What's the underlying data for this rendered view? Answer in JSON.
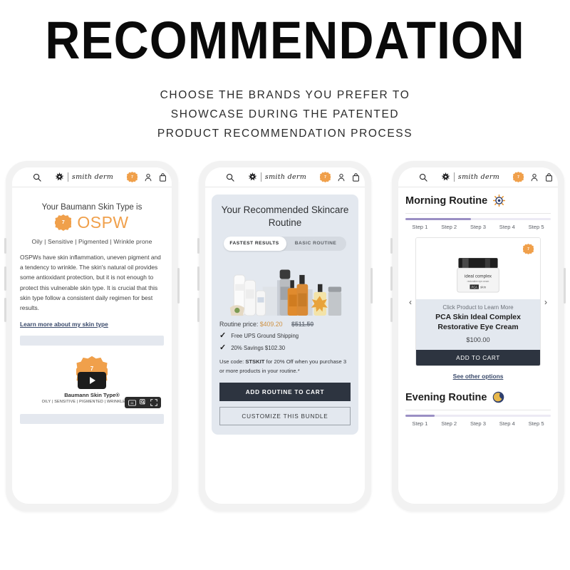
{
  "header": {
    "title": "RECOMMENDATION",
    "subtitle_lines": [
      "CHOOSE THE BRANDS YOU PREFER TO",
      "SHOWCASE DURING THE PATENTED",
      "PRODUCT RECOMMENDATION PROCESS"
    ]
  },
  "appbar": {
    "brand_name": "smith derm",
    "badge_count": "7",
    "menu_icon": "hamburger-icon",
    "search_icon": "search-icon",
    "account_icon": "account-icon",
    "bag_icon": "shopping-bag-icon"
  },
  "colors": {
    "accent_orange": "#f0a04b",
    "dark_button": "#2d3440",
    "card_blue_grey": "#e3e8ef",
    "progress_purple": "#9a8fc4",
    "link_navy": "#3a4a6b"
  },
  "phone1": {
    "heading": "Your Baumann Skin Type is",
    "badge_count": "7",
    "skin_type_code": "OSPW",
    "attributes": "Oily | Sensitive | Pigmented | Wrinkle prone",
    "description": "OSPWs have skin inflammation, uneven pigment and a tendency to wrinkle. The skin's natural oil provides some antioxidant protection, but it is not enough to protect this vulnerable skin type. It is crucial that this skin type follow a consistent daily regimen for best results.",
    "learn_link": "Learn more about my skin type",
    "video": {
      "badge_count": "7",
      "caption_title": "Baumann Skin Type®",
      "caption_sub": "OILY | SENSITIVE | PIGMENTED | WRINKLE–PRONE",
      "play_icon": "play-icon",
      "controls": [
        "closed-caption-icon",
        "zoom-search-icon",
        "fullscreen-icon"
      ]
    }
  },
  "phone2": {
    "title": "Your Recommended Skincare Routine",
    "tabs": [
      {
        "label": "FASTEST RESULTS",
        "selected": true
      },
      {
        "label": "BASIC ROUTINE",
        "selected": false
      }
    ],
    "price_label": "Routine price:",
    "price_now": "$409.20",
    "price_was": "$511.50",
    "benefits": [
      "Free UPS Ground Shipping",
      "20% Savings $102.30"
    ],
    "promo_prefix": "Use code:",
    "promo_code": "STSKIT",
    "promo_suffix": "for 20% Off when you purchase 3 or more products in your routine.*",
    "primary_button": "ADD ROUTINE TO CART",
    "secondary_button": "CUSTOMIZE THIS BUNDLE"
  },
  "phone3": {
    "morning": {
      "title": "Morning Routine",
      "icon": "sun-icon",
      "steps": [
        "Step 1",
        "Step 2",
        "Step 3",
        "Step 4",
        "Step 5"
      ],
      "progress_percent": 45
    },
    "evening": {
      "title": "Evening Routine",
      "icon": "moon-icon",
      "steps": [
        "Step 1",
        "Step 2",
        "Step 3",
        "Step 4",
        "Step 5"
      ],
      "progress_percent": 20
    },
    "carousel": {
      "prev_icon": "chevron-left-icon",
      "next_icon": "chevron-right-icon",
      "badge_count": "7",
      "learn_more": "Click Product to Learn More",
      "product_name": "PCA Skin Ideal Complex Restorative Eye Cream",
      "product_price": "$100.00",
      "add_to_cart": "ADD TO CART",
      "other_options": "See other options",
      "product_label_main": "ideal complex",
      "product_label_sub": "restorative eye cream",
      "product_brand": "PCA skin"
    }
  }
}
